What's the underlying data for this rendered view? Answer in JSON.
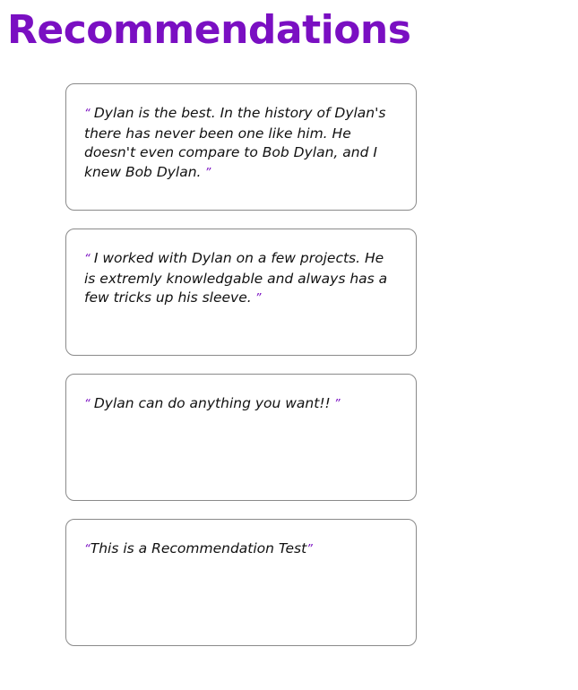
{
  "page": {
    "title": "Recommendations"
  },
  "colors": {
    "accent": "#7a0fc2",
    "card_border": "#8a8a8a",
    "text": "#111111"
  },
  "recommendations": [
    {
      "open_mark": "“ ",
      "text": "Dylan is the best. In the history of Dylan's there has never been one like him. He doesn't even compare to Bob Dylan, and I knew Bob Dylan.",
      "close_mark": " ”"
    },
    {
      "open_mark": "“ ",
      "text": "I worked with Dylan on a few projects. He is extremly knowledgable and always has a few tricks up his sleeve.",
      "close_mark": " ”"
    },
    {
      "open_mark": "“ ",
      "text": "Dylan can do anything you want!!",
      "close_mark": " ”"
    },
    {
      "open_mark": "“",
      "text": "This is a Recommendation Test",
      "close_mark": "”"
    }
  ]
}
